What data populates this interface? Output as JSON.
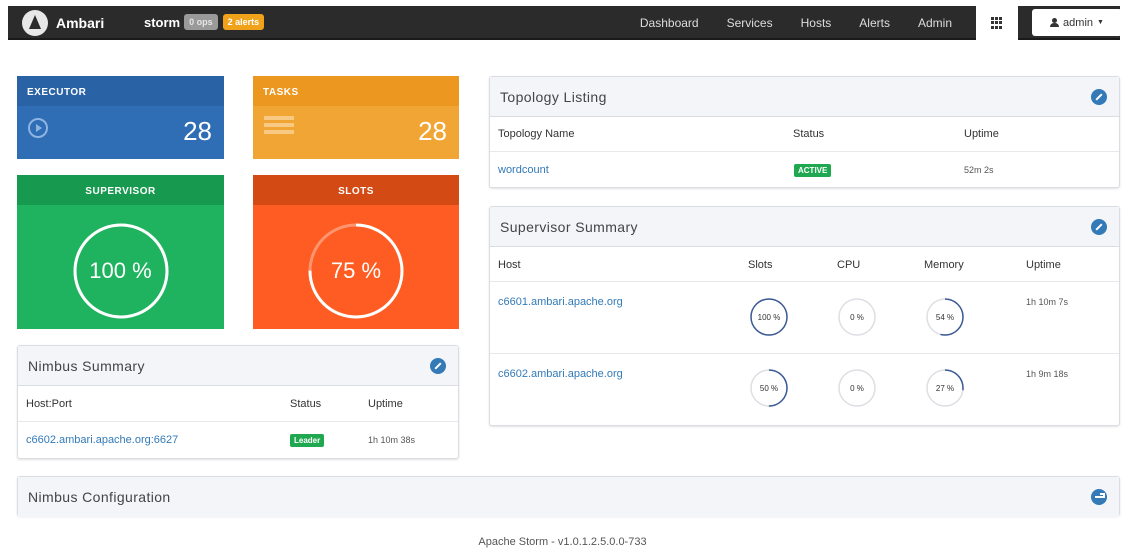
{
  "navbar": {
    "brand": "Ambari",
    "cluster": "storm",
    "ops_badge": "0 ops",
    "alerts_badge": "2 alerts",
    "links": [
      "Dashboard",
      "Services",
      "Hosts",
      "Alerts",
      "Admin"
    ],
    "user": "admin"
  },
  "tiles": {
    "executor": {
      "label": "EXECUTOR",
      "value": "28"
    },
    "tasks": {
      "label": "TASKS",
      "value": "28"
    },
    "supervisor": {
      "label": "SUPERVISOR",
      "value": "100 %",
      "percent": 100
    },
    "slots": {
      "label": "SLOTS",
      "value": "75 %",
      "percent": 75
    }
  },
  "topology_listing": {
    "title": "Topology Listing",
    "headers": [
      "Topology Name",
      "Status",
      "Uptime"
    ],
    "rows": [
      {
        "name": "wordcount",
        "status": "ACTIVE",
        "uptime": "52m 2s"
      }
    ]
  },
  "supervisor_summary": {
    "title": "Supervisor Summary",
    "headers": [
      "Host",
      "Slots",
      "CPU",
      "Memory",
      "Uptime"
    ],
    "rows": [
      {
        "host": "c6601.ambari.apache.org",
        "slots": "100 %",
        "slots_pct": 100,
        "cpu": "0 %",
        "cpu_pct": 0,
        "memory": "54 %",
        "memory_pct": 54,
        "uptime": "1h 10m 7s"
      },
      {
        "host": "c6602.ambari.apache.org",
        "slots": "50 %",
        "slots_pct": 50,
        "cpu": "0 %",
        "cpu_pct": 0,
        "memory": "27 %",
        "memory_pct": 27,
        "uptime": "1h 9m 18s"
      }
    ]
  },
  "nimbus_summary": {
    "title": "Nimbus Summary",
    "headers": [
      "Host:Port",
      "Status",
      "Uptime"
    ],
    "rows": [
      {
        "host_port": "c6602.ambari.apache.org:6627",
        "status": "Leader",
        "uptime": "1h 10m 38s"
      }
    ]
  },
  "nimbus_configuration": {
    "title": "Nimbus Configuration"
  },
  "footer": "Apache Storm - v1.0.1.2.5.0.0-733",
  "colors": {
    "executor": "#2f6db5",
    "tasks": "#f0a535",
    "supervisor": "#1fb35f",
    "slots": "#fe5c22",
    "link": "#337ab7",
    "active": "#1fa84f"
  }
}
